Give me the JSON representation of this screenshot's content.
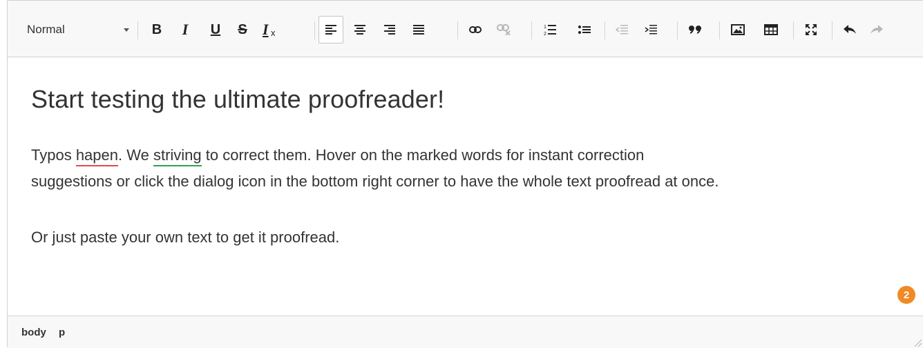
{
  "toolbar": {
    "format_select": {
      "value": "Normal"
    },
    "buttons": [
      {
        "name": "bold",
        "glyph": "B"
      },
      {
        "name": "italic",
        "glyph": "I"
      },
      {
        "name": "underline",
        "glyph": "U"
      },
      {
        "name": "strikethrough",
        "glyph": "S"
      },
      {
        "name": "remove-format",
        "glyph": "Tx"
      },
      {
        "name": "align-left",
        "active": true
      },
      {
        "name": "align-center"
      },
      {
        "name": "align-right"
      },
      {
        "name": "align-justify"
      },
      {
        "name": "link"
      },
      {
        "name": "unlink",
        "disabled": true
      },
      {
        "name": "numbered-list"
      },
      {
        "name": "bulleted-list"
      },
      {
        "name": "outdent",
        "disabled": true
      },
      {
        "name": "indent"
      },
      {
        "name": "blockquote"
      },
      {
        "name": "image"
      },
      {
        "name": "table"
      },
      {
        "name": "maximize"
      },
      {
        "name": "undo"
      },
      {
        "name": "redo",
        "disabled": true
      }
    ]
  },
  "content": {
    "heading": "Start testing the ultimate proofreader!",
    "p1": {
      "before": "Typos ",
      "spelling_error": "hapen",
      "middle": ". We ",
      "grammar_error": "striving",
      "after": " to correct them. Hover on the marked words for instant correction"
    },
    "p1_line2": "suggestions or click the dialog icon in the bottom right corner to have the whole text proofread at once.",
    "p2": "Or just paste your own text to get it proofread."
  },
  "proofreader_badge": {
    "count": "2",
    "color": "#f08a24"
  },
  "statusbar": {
    "path": [
      "body",
      "p"
    ]
  },
  "colors": {
    "spelling_underline": "#e5484d",
    "grammar_underline": "#2ba34e"
  }
}
